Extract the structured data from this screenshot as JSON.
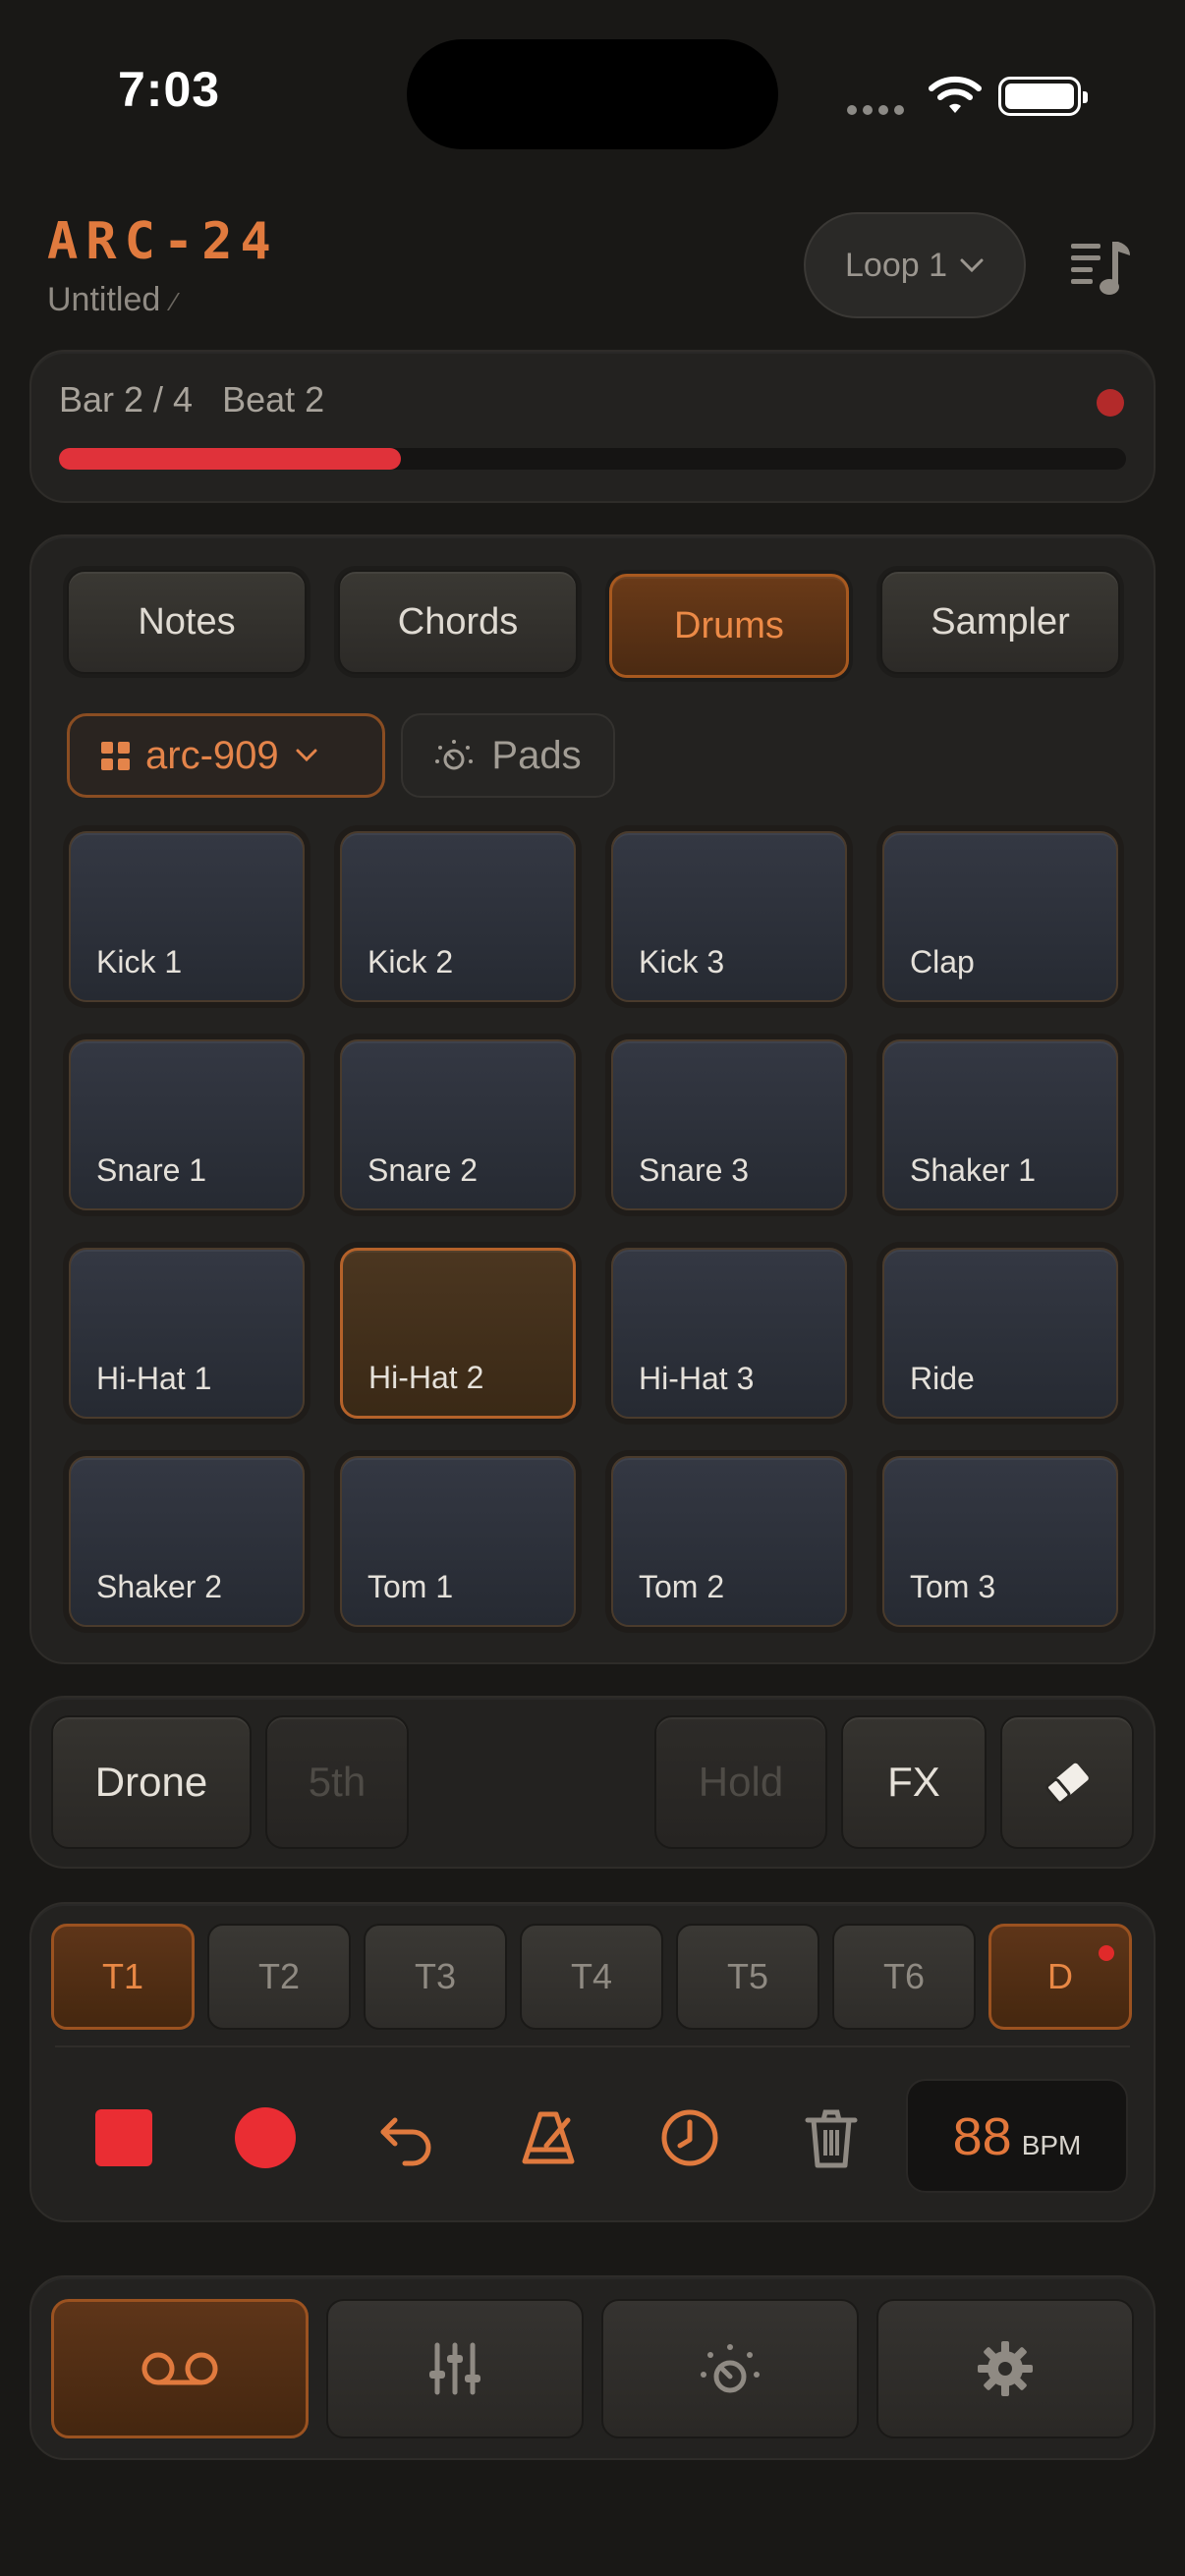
{
  "status_bar": {
    "time": "7:03"
  },
  "header": {
    "app_title": "ARC-24",
    "project_name": "Untitled",
    "loop_select": "Loop 1"
  },
  "progress": {
    "bar": "Bar 2 / 4",
    "beat": "Beat 2",
    "fraction": 0.32,
    "accent": "#e0323a"
  },
  "instrument_tabs": [
    {
      "label": "Notes"
    },
    {
      "label": "Chords"
    },
    {
      "label": "Drums",
      "active": true
    },
    {
      "label": "Sampler"
    }
  ],
  "kit": {
    "name": "arc-909",
    "pads_label": "Pads"
  },
  "pads": [
    {
      "label": "Kick 1"
    },
    {
      "label": "Kick 2"
    },
    {
      "label": "Kick 3"
    },
    {
      "label": "Clap"
    },
    {
      "label": "Snare 1"
    },
    {
      "label": "Snare 2"
    },
    {
      "label": "Snare 3"
    },
    {
      "label": "Shaker 1"
    },
    {
      "label": "Hi-Hat 1"
    },
    {
      "label": "Hi-Hat 2",
      "active": true
    },
    {
      "label": "Hi-Hat 3"
    },
    {
      "label": "Ride"
    },
    {
      "label": "Shaker 2"
    },
    {
      "label": "Tom 1"
    },
    {
      "label": "Tom 2"
    },
    {
      "label": "Tom 3"
    }
  ],
  "drone_row": {
    "drone": "Drone",
    "fifth": "5th",
    "hold": "Hold",
    "fx": "FX"
  },
  "tracks": [
    {
      "label": "T1",
      "active": true
    },
    {
      "label": "T2"
    },
    {
      "label": "T3"
    },
    {
      "label": "T4"
    },
    {
      "label": "T5"
    },
    {
      "label": "T6"
    },
    {
      "label": "D",
      "active": true
    }
  ],
  "transport": {
    "bpm": "88",
    "bpm_unit": "BPM",
    "tools": [
      "stop-icon",
      "record-icon",
      "undo-icon",
      "metronome-icon",
      "clock-icon",
      "trash-icon"
    ]
  },
  "bottom_nav": [
    "voicemail-icon",
    "sliders-icon",
    "dial-icon",
    "gear-icon"
  ],
  "colors": {
    "accent_orange": "#e07a3e",
    "record_red": "#ea2d33",
    "background": "#191816"
  }
}
